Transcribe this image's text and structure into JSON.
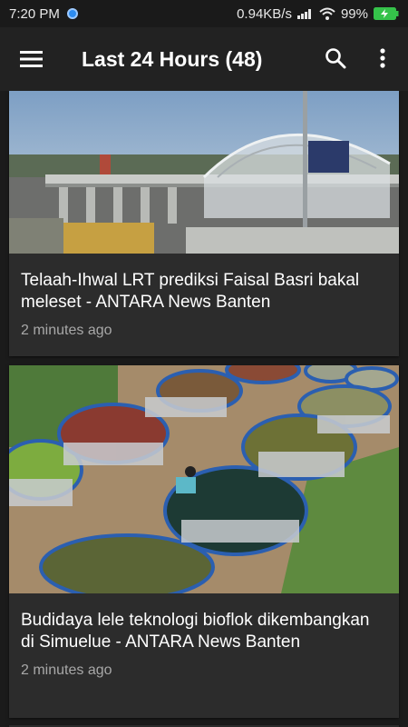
{
  "status_bar": {
    "time": "7:20 PM",
    "network_speed": "0.94KB/s",
    "battery_percent": "99%",
    "icons": [
      "app-notification-icon",
      "signal-icon",
      "wifi-icon",
      "battery-charging-icon"
    ]
  },
  "app_bar": {
    "title": "Last 24 Hours (48)",
    "icons": [
      "hamburger-menu-icon",
      "search-icon",
      "overflow-menu-icon"
    ]
  },
  "feed": {
    "articles": [
      {
        "title": "Telaah-Ihwal LRT prediksi Faisal Basri bakal meleset - ANTARA News Banten",
        "time": "2 minutes ago",
        "image": "lrt-elevated-station-photo"
      },
      {
        "title": "Budidaya lele teknologi bioflok dikembangkan di Simuelue - ANTARA News Banten",
        "time": "2 minutes ago",
        "image": "biofloc-catfish-ponds-photo"
      }
    ]
  },
  "colors": {
    "background": "#1b1b1b",
    "app_bar": "#222222",
    "card": "#2c2c2c",
    "secondary_text": "#a8a8a8",
    "battery": "#35c24a"
  }
}
